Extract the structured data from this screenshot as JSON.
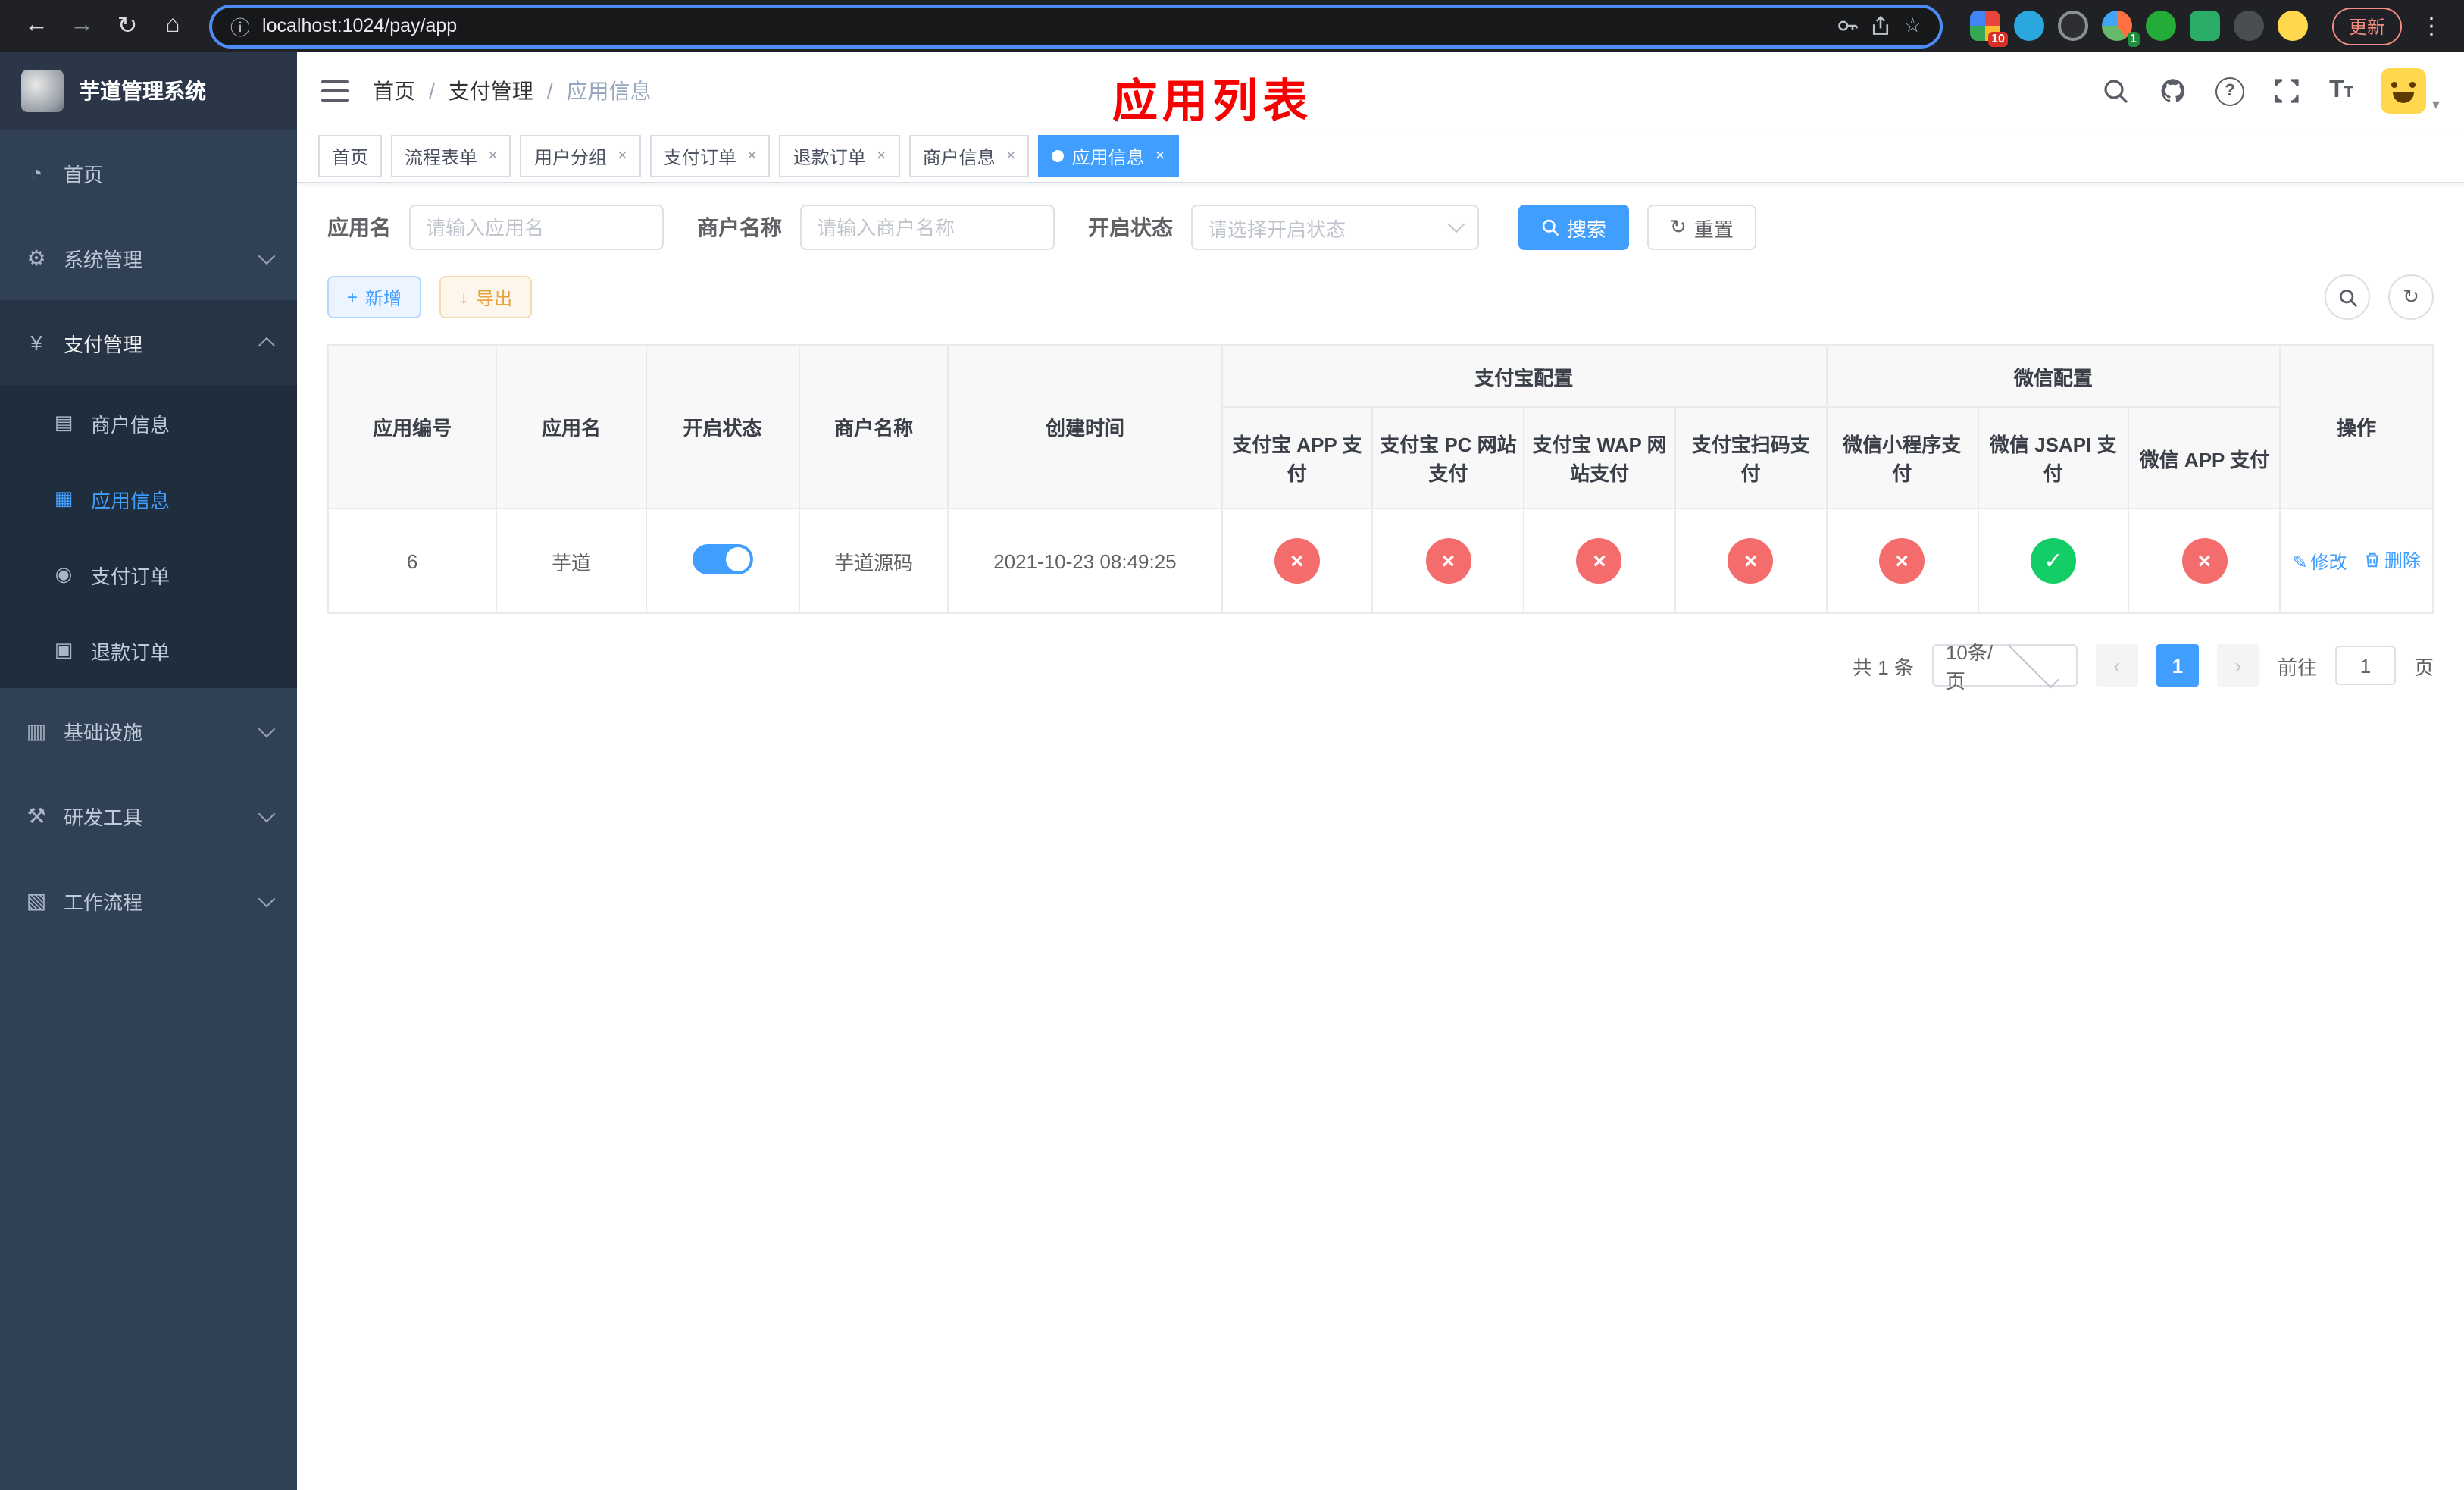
{
  "browser": {
    "url": "localhost:1024/pay/app",
    "update_label": "更新",
    "ext_badge_1": "10",
    "ext_badge_2": "1"
  },
  "icons": {
    "back": "←",
    "forward": "→",
    "reload": "↻",
    "home": "⌂",
    "info": "ⓘ",
    "star": "☆",
    "menu_dots": "⋮",
    "caret": "▾",
    "menu_home": "◔",
    "menu_system": "⚙",
    "menu_pay": "¥",
    "menu_merchant": "▤",
    "menu_app": "▦",
    "menu_order": "◉",
    "menu_refund": "▣",
    "menu_infra": "▥",
    "menu_dev": "⚒",
    "menu_flow": "▧",
    "refresh": "↻",
    "plus": "+",
    "download": "↓",
    "edit": "✎",
    "prev": "‹",
    "next": "›"
  },
  "sidebar": {
    "title": "芋道管理系统",
    "items": {
      "home": "首页",
      "system": "系统管理",
      "pay": "支付管理",
      "merchant": "商户信息",
      "app": "应用信息",
      "order": "支付订单",
      "refund": "退款订单",
      "infra": "基础设施",
      "dev": "研发工具",
      "workflow": "工作流程"
    }
  },
  "header": {
    "breadcrumb": [
      "首页",
      "支付管理",
      "应用信息"
    ],
    "separator": "/",
    "title": "应用列表"
  },
  "tabs": [
    {
      "label": "首页"
    },
    {
      "label": "流程表单"
    },
    {
      "label": "用户分组"
    },
    {
      "label": "支付订单"
    },
    {
      "label": "退款订单"
    },
    {
      "label": "商户信息"
    },
    {
      "label": "应用信息"
    }
  ],
  "filters": {
    "app_name": {
      "label": "应用名",
      "placeholder": "请输入应用名"
    },
    "merchant_name": {
      "label": "商户名称",
      "placeholder": "请输入商户名称"
    },
    "status": {
      "label": "开启状态",
      "placeholder": "请选择开启状态"
    },
    "search_label": "搜索",
    "reset_label": "重置"
  },
  "toolbar": {
    "add_label": "新增",
    "export_label": "导出"
  },
  "table": {
    "group_headers": {
      "alipay": "支付宝配置",
      "wechat": "微信配置"
    },
    "columns": {
      "id": "应用编号",
      "name": "应用名",
      "status": "开启状态",
      "merchant": "商户名称",
      "created": "创建时间",
      "alipay_app": "支付宝 APP 支付",
      "alipay_pc": "支付宝 PC 网站支付",
      "alipay_wap": "支付宝 WAP 网站支付",
      "alipay_qr": "支付宝扫码支付",
      "wx_lite": "微信小程序支付",
      "wx_jsapi": "微信 JSAPI 支付",
      "wx_app": "微信 APP 支付",
      "actions": "操作"
    },
    "row": {
      "id": "6",
      "name": "芋道",
      "enabled": true,
      "merchant": "芋道源码",
      "created": "2021-10-23 08:49:25",
      "channels": {
        "alipay_app": "fail",
        "alipay_pc": "fail",
        "alipay_wap": "fail",
        "alipay_qr": "fail",
        "wx_lite": "fail",
        "wx_jsapi": "success",
        "wx_app": "fail"
      },
      "edit_label": "修改",
      "delete_label": "删除"
    }
  },
  "pagination": {
    "total_text": "共 1 条",
    "page_size": "10条/页",
    "current_page": "1",
    "goto_label": "前往",
    "goto_value": "1",
    "page_suffix": "页"
  },
  "colors": {
    "primary": "#409eff",
    "danger": "#f56c6c",
    "success": "#13ce66",
    "title_red": "#f70000"
  }
}
